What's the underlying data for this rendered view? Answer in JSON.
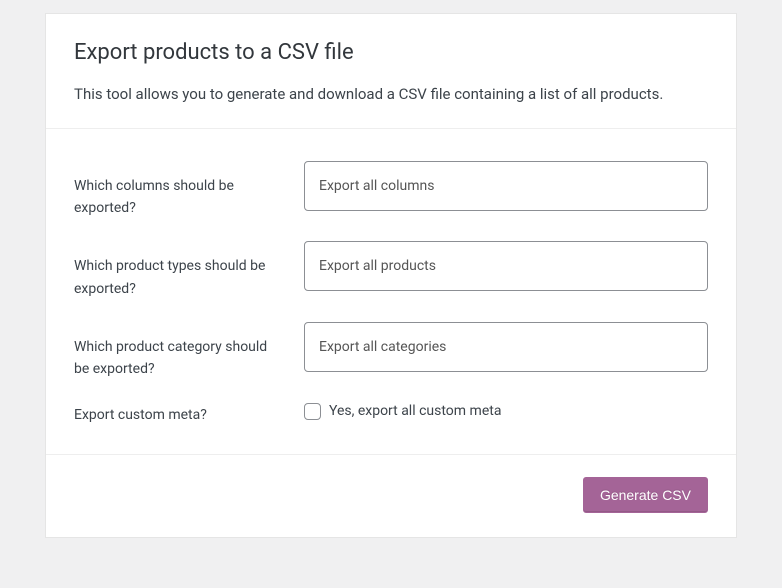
{
  "header": {
    "title": "Export products to a CSV file",
    "description": "This tool allows you to generate and download a CSV file containing a list of all products."
  },
  "form": {
    "columns": {
      "label": "Which columns should be exported?",
      "placeholder": "Export all columns"
    },
    "types": {
      "label": "Which product types should be exported?",
      "placeholder": "Export all products"
    },
    "categories": {
      "label": "Which product category should be exported?",
      "placeholder": "Export all categories"
    },
    "meta": {
      "label": "Export custom meta?",
      "checkbox_label": "Yes, export all custom meta"
    }
  },
  "footer": {
    "submit_label": "Generate CSV"
  }
}
